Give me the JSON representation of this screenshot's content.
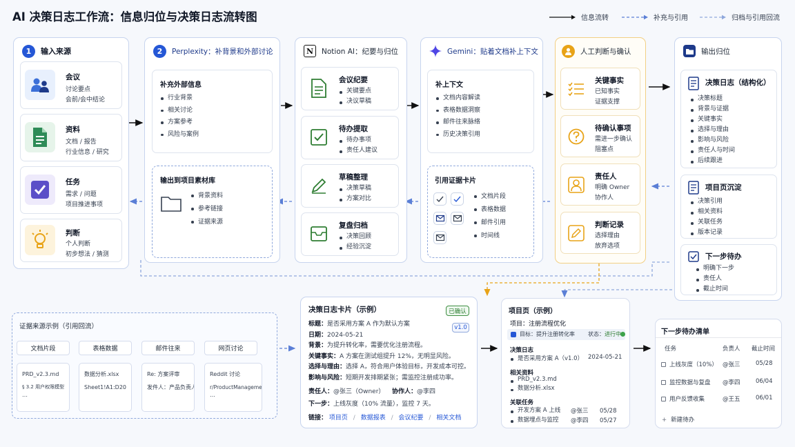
{
  "title": "AI 决策日志工作流：信息归位与决策日志流转图",
  "legend": {
    "flow": "信息流转",
    "supplement": "补充与引用",
    "archive": "归档与引用回流"
  },
  "input": {
    "num": "1",
    "title": "输入来源",
    "items": [
      {
        "title": "会议",
        "lines": [
          "讨论要点",
          "会前/会中结论"
        ]
      },
      {
        "title": "资料",
        "lines": [
          "文档 / 报告",
          "行业信息 / 研究"
        ]
      },
      {
        "title": "任务",
        "lines": [
          "需求 / 问题",
          "项目推进事项"
        ]
      },
      {
        "title": "判断",
        "lines": [
          "个人判断",
          "初步想法 / 猜测"
        ]
      }
    ]
  },
  "perplexity": {
    "num": "2",
    "title": "Perplexity：补背景和外部讨论",
    "card_title": "补充外部信息",
    "bullets": [
      "行业背景",
      "相关讨论",
      "方案参考",
      "风险与案例"
    ],
    "output_title": "输出到项目素材库",
    "output_bullets": [
      "背景资料",
      "参考链接",
      "证据来源"
    ]
  },
  "notion": {
    "logo": "N",
    "title": "Notion AI：纪要与归位",
    "cards": [
      {
        "title": "会议纪要",
        "bullets": [
          "关键要点",
          "决议草稿"
        ]
      },
      {
        "title": "待办提取",
        "bullets": [
          "待办事项",
          "责任人建议"
        ]
      },
      {
        "title": "草稿整理",
        "bullets": [
          "决策草稿",
          "方案对比"
        ]
      },
      {
        "title": "复盘归档",
        "bullets": [
          "决策回顾",
          "经验沉淀"
        ]
      }
    ]
  },
  "gemini": {
    "title": "Gemini：贴着文档补上下文",
    "card_title": "补上下文",
    "bullets": [
      "文档内容解读",
      "表格数据洞察",
      "邮件往来脉络",
      "历史决策引用"
    ],
    "evidence_title": "引用证据卡片",
    "evidence_bullets": [
      "文档片段",
      "表格数据",
      "邮件引用",
      "时间线"
    ]
  },
  "human": {
    "title": "人工判断与确认",
    "cards": [
      {
        "title": "关键事实",
        "lines": [
          "已知事实",
          "证据支撑"
        ]
      },
      {
        "title": "待确认事项",
        "lines": [
          "需进一步确认",
          "阻塞点"
        ]
      },
      {
        "title": "责任人",
        "lines": [
          "明确 Owner",
          "协作人"
        ]
      },
      {
        "title": "判断记录",
        "lines": [
          "选择理由",
          "放弃选项"
        ]
      }
    ]
  },
  "output": {
    "title": "输出归位",
    "decision_log": {
      "title": "决策日志（结构化）",
      "bullets": [
        "决策标题",
        "背景与证据",
        "关键事实",
        "选择与理由",
        "影响与风险",
        "责任人与时间",
        "后续跟进"
      ]
    },
    "project_page": {
      "title": "项目页沉淀",
      "bullets": [
        "决策引用",
        "相关资料",
        "关联任务",
        "版本记录"
      ]
    },
    "next_todo": {
      "title": "下一步待办",
      "bullets": [
        "明确下一步",
        "责任人",
        "截止时间"
      ]
    }
  },
  "evidence_examples": {
    "title": "证据来源示例（引用回流）",
    "columns": [
      {
        "header": "文档片段",
        "lines": [
          "PRD_v2.3.md",
          "§ 3.2 用户权限模型",
          "…"
        ]
      },
      {
        "header": "表格数据",
        "lines": [
          "数据分析.xlsx",
          "Sheet1!A1:D20"
        ]
      },
      {
        "header": "邮件往来",
        "lines": [
          "Re: 方案评审",
          "发件人：产品负责人"
        ]
      },
      {
        "header": "网页讨论",
        "lines": [
          "Reddit 讨论",
          "r/ProductManagement",
          "…"
        ]
      }
    ]
  },
  "decision_card": {
    "title": "决策日志卡片（示例）",
    "badge": "已确认",
    "version": "v1.0",
    "fields": [
      {
        "label": "标题：",
        "value": "是否采用方案 A 作为默认方案"
      },
      {
        "label": "日期：",
        "value": "2024-05-21"
      },
      {
        "label": "背景：",
        "value": "为提升转化率，需要优化注册流程。"
      },
      {
        "label": "关键事实：",
        "value": "A 方案在测试组提升 12%，无明显风险。"
      },
      {
        "label": "选择与理由：",
        "value": "选择 A，符合用户体验目标，开发成本可控。"
      },
      {
        "label": "影响与风险：",
        "value": "短期开发排期紧张；需监控注册成功率。"
      }
    ],
    "owner_label": "责任人：",
    "owner": "@张三（Owner）",
    "collab_label": "协作人：",
    "collab": "@李四",
    "next_label": "下一步：",
    "next": "上线灰度（10% 流量），监控 7 天。",
    "links_label": "链接：",
    "links": [
      "项目页",
      "数据报表",
      "会议纪要",
      "相关文档"
    ]
  },
  "project_page_example": {
    "title": "项目页（示例）",
    "project_label": "项目：注册流程优化",
    "goal": "目标：提升注册转化率",
    "status_label": "状态：",
    "status": "进行中",
    "decision_log_title": "决策日志",
    "decision_item": "是否采用方案 A（v1.0）",
    "decision_date": "2024-05-21",
    "files_title": "相关资料",
    "files": [
      "PRD_v2.3.md",
      "数据分析.xlsx"
    ],
    "tasks_title": "关联任务",
    "tasks": [
      {
        "name": "开发方案 A 上线",
        "owner": "@张三",
        "date": "05/28"
      },
      {
        "name": "数据埋点与监控",
        "owner": "@李四",
        "date": "05/27"
      }
    ]
  },
  "todo_list": {
    "title": "下一步待办清单",
    "headers": [
      "任务",
      "负责人",
      "截止时间"
    ],
    "rows": [
      {
        "task": "上线灰度（10%）",
        "owner": "@张三",
        "due": "05/28"
      },
      {
        "task": "监控数据与复盘",
        "owner": "@李四",
        "due": "06/04"
      },
      {
        "task": "用户反馈收集",
        "owner": "@王五",
        "due": "06/01"
      }
    ],
    "add": "新建待办"
  },
  "colors": {
    "accent": "#2557d6",
    "gold": "#e8a317",
    "green": "#2e7d32"
  }
}
